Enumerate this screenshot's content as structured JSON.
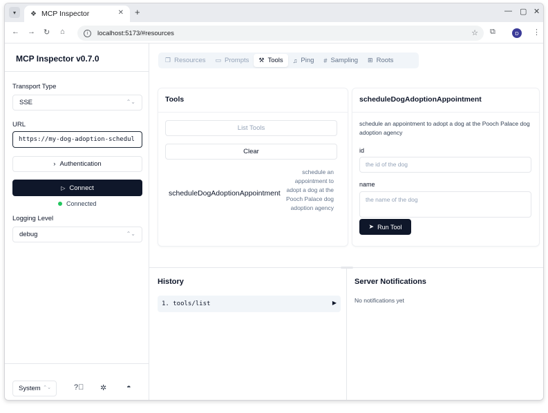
{
  "browser": {
    "tab_title": "MCP Inspector",
    "url": "localhost:5173/#resources",
    "profile_initial": "D",
    "icons": {
      "tab_menu": "chevron-down-icon",
      "favicon": "mcp-logo-icon",
      "close": "close-icon",
      "new_tab": "plus-icon",
      "back": "arrow-left-icon",
      "forward": "arrow-right-icon",
      "reload": "reload-icon",
      "home": "home-icon",
      "site_info": "info-icon",
      "bookmark": "star-icon",
      "extensions": "puzzle-icon",
      "menu": "kebab-icon",
      "minimize": "minimize-icon",
      "maximize": "maximize-icon",
      "window_close": "close-icon"
    }
  },
  "sidebar": {
    "title": "MCP Inspector v0.7.0",
    "transport_label": "Transport Type",
    "transport_value": "SSE",
    "url_label": "URL",
    "url_value": "https://my-dog-adoption-schedul",
    "auth_label": "Authentication",
    "connect_label": "Connect",
    "status": "Connected",
    "status_color": "#22c55e",
    "logging_label": "Logging Level",
    "logging_value": "debug",
    "theme_value": "System",
    "footer_icons": [
      "help-icon",
      "bug-icon",
      "github-icon"
    ]
  },
  "tabs": [
    {
      "label": "Resources",
      "icon": "files-icon",
      "state": "disabled"
    },
    {
      "label": "Prompts",
      "icon": "message-icon",
      "state": "disabled"
    },
    {
      "label": "Tools",
      "icon": "wrench-icon",
      "state": "active"
    },
    {
      "label": "Ping",
      "icon": "bell-icon",
      "state": "normal"
    },
    {
      "label": "Sampling",
      "icon": "hash-icon",
      "state": "normal"
    },
    {
      "label": "Roots",
      "icon": "folder-tree-icon",
      "state": "normal"
    }
  ],
  "tools_panel": {
    "title": "Tools",
    "list_tools_label": "List Tools",
    "clear_label": "Clear",
    "tool_name": "scheduleDogAdoptionAppointment",
    "tool_description": "schedule an appointment to adopt a dog at the Pooch Palace dog adoption agency"
  },
  "detail_panel": {
    "title": "scheduleDogAdoptionAppointment",
    "description": "schedule an appointment to adopt a dog at the Pooch Palace dog adoption agency",
    "field_id_label": "id",
    "field_id_placeholder": "the id of the dog",
    "field_name_label": "name",
    "field_name_placeholder": "the name of the dog",
    "run_label": "Run Tool"
  },
  "history": {
    "title": "History",
    "items": [
      "1. tools/list"
    ]
  },
  "notifications": {
    "title": "Server Notifications",
    "empty_text": "No notifications yet"
  }
}
